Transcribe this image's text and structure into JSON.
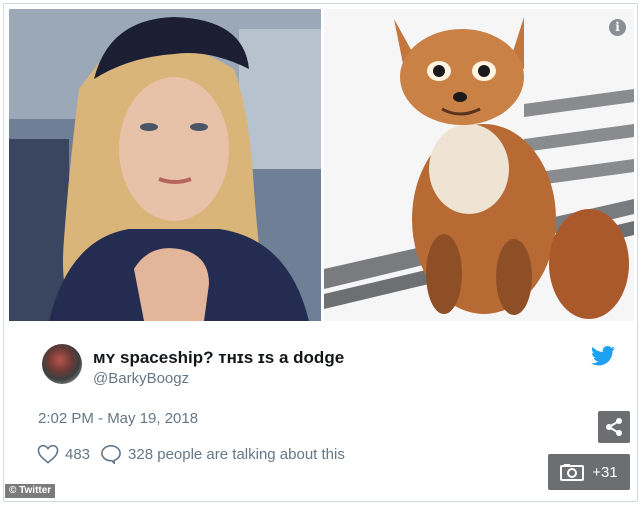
{
  "tweet": {
    "display_name": "ᴍʏ spaceship? ᴛʜɪs ɪs a dodge",
    "handle": "@BarkyBoogz",
    "timestamp": "2:02 PM - May 19, 2018",
    "likes": "483",
    "replies_text": "328 people are talking about this"
  },
  "overlay": {
    "gallery_count": "+31",
    "credit": "© Twitter"
  },
  "colors": {
    "twitter_blue": "#1da1f2",
    "muted_text": "#657786",
    "button_gray": "#6d6e71"
  },
  "icons": [
    "info-icon",
    "twitter-bird-icon",
    "heart-icon",
    "speech-bubble-icon",
    "share-icon",
    "camera-icon"
  ]
}
